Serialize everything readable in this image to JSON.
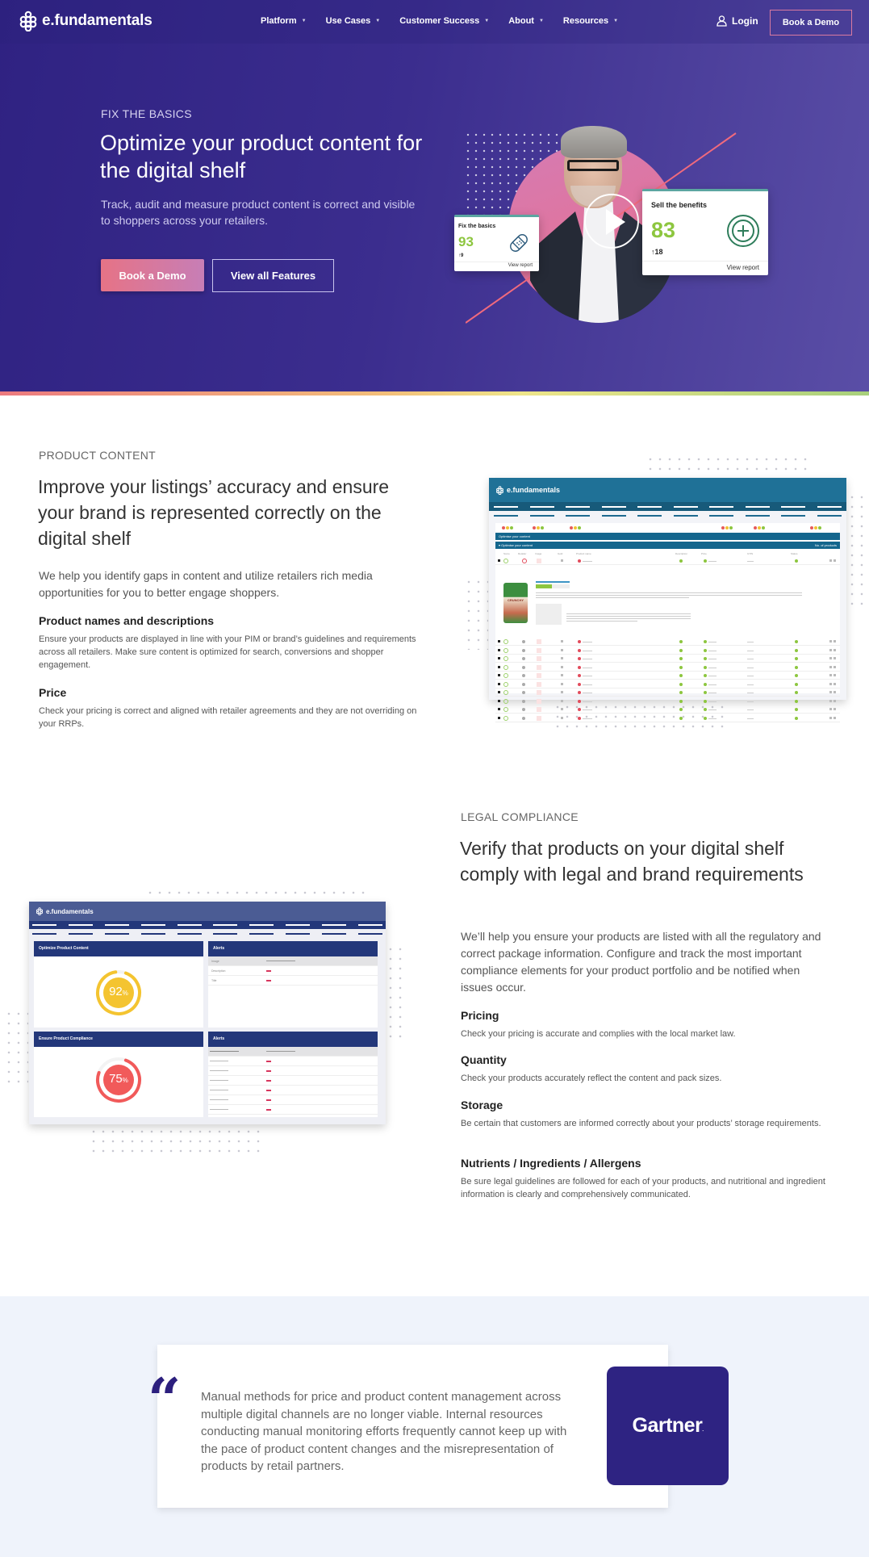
{
  "brand": {
    "name": "e.fundamentals",
    "primary": "#2f2282",
    "accent_pink": "#e67386",
    "green": "#8dc63f"
  },
  "nav": {
    "links": [
      {
        "label": "Platform",
        "has_dropdown": true
      },
      {
        "label": "Use Cases",
        "has_dropdown": true
      },
      {
        "label": "Customer Success",
        "has_dropdown": true
      },
      {
        "label": "About",
        "has_dropdown": true
      },
      {
        "label": "Resources",
        "has_dropdown": true
      }
    ],
    "caret": "▼",
    "login_label": "Login",
    "demo_label": "Book a Demo"
  },
  "hero": {
    "eyebrow": "FIX THE BASICS",
    "title": "Optimize your product content for the digital shelf",
    "subtitle": "Track, audit and measure product content is correct and visible to shoppers across your retailers.",
    "primary_cta": "Book a Demo",
    "secondary_cta": "View all Features",
    "cards": [
      {
        "title": "Fix the basics",
        "score": "93",
        "delta": "↑9",
        "link": "View report",
        "icon": "bandage-icon"
      },
      {
        "title": "Sell the benefits",
        "score": "83",
        "delta": "↑18",
        "link": "View report",
        "icon": "plus-circle-icon"
      }
    ]
  },
  "product_content": {
    "eyebrow": "PRODUCT CONTENT",
    "title": "Improve your listings’ accuracy and ensure your brand is represented correctly on the digital shelf",
    "lead": "We help you identify gaps in content and utilize retailers rich media opportunities for you to better engage shoppers.",
    "features": [
      {
        "heading": "Product names and descriptions",
        "text": "Ensure your products are displayed in line with your PIM or brand’s guidelines and requirements across all retailers. Make sure content is optimized for search, conversions and shopper engagement."
      },
      {
        "heading": "Price",
        "text": "Check your pricing is correct and aligned with retailer agreements and they are not overriding on your RRPs."
      }
    ],
    "mock": {
      "brand": "e.fundamentals",
      "bar1": "Optimise your content",
      "bar2": "Optimise your content",
      "bar2_right": "No. of products",
      "columns": [
        "Score",
        "Retailer",
        "Image",
        "Gold",
        "Product name",
        "Description",
        "Price",
        "GTIN",
        "Status"
      ],
      "product_label": "CRUNCHY",
      "row_count": 10
    }
  },
  "legal": {
    "eyebrow": "LEGAL COMPLIANCE",
    "title": "Verify that products on your digital shelf comply with legal and brand requirements",
    "lead": "We’ll help you ensure your products are listed with all the regulatory and correct package information. Configure and track the most important compliance elements for your product portfolio and be notified when issues occur.",
    "features": [
      {
        "heading": "Pricing",
        "text": "Check your pricing is accurate and complies with the local market law."
      },
      {
        "heading": "Quantity",
        "text": "Check your products accurately reflect the content and pack sizes."
      },
      {
        "heading": "Storage",
        "text": "Be certain that customers are informed correctly about your products’ storage requirements."
      },
      {
        "heading": "Nutrients / Ingredients / Allergens",
        "text": "Be sure legal guidelines are followed for each of your products, and nutritional and ingredient information is clearly and comprehensively communicated."
      }
    ],
    "mock": {
      "brand": "e.fundamentals",
      "panels": [
        {
          "title": "Optimize Product Content",
          "value": 92,
          "display": "92",
          "unit": "%",
          "color": "#f4c430"
        },
        {
          "title": "Ensure Product Compliance",
          "value": 75,
          "display": "75",
          "unit": "%",
          "color": "#f15a5a"
        }
      ],
      "alerts_title": "Alerts",
      "alerts_rows_1": [
        "Image",
        "Description",
        "Title"
      ]
    }
  },
  "quote": {
    "mark": "“",
    "text": "Manual methods for price and product content management across multiple digital channels are no longer viable. Internal resources conducting manual monitoring efforts frequently cannot keep up with the pace of product content changes and the misrepresentation of products by retail partners.",
    "source_logo": "Gartner",
    "source_logo_dot": "."
  }
}
